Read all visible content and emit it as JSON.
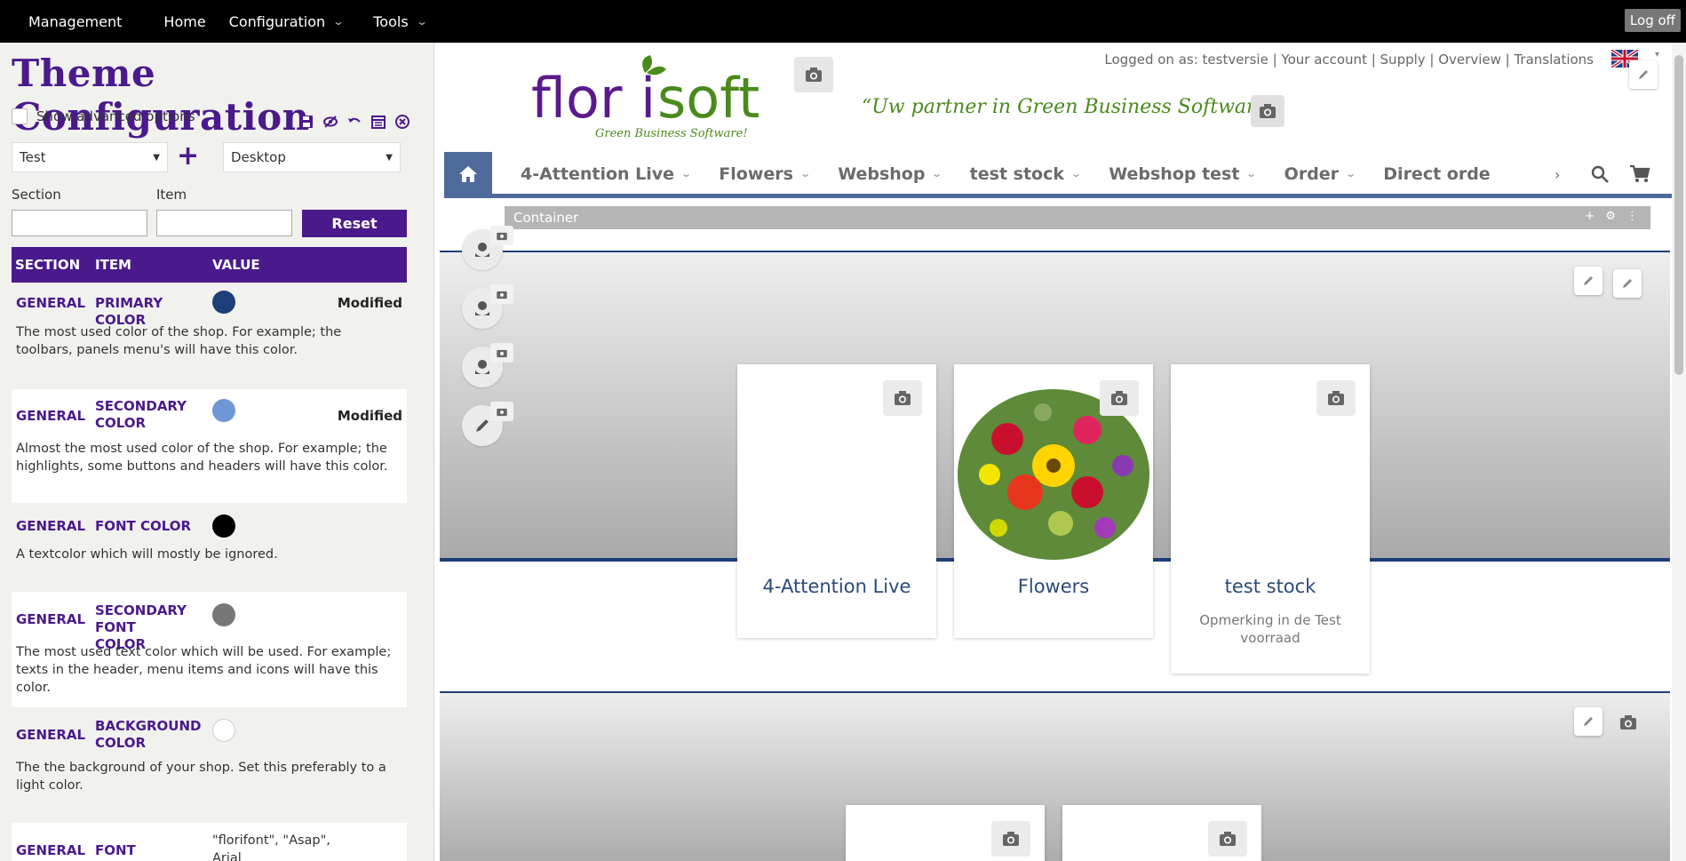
{
  "topbar": {
    "management": "Management",
    "home": "Home",
    "configuration": "Configuration",
    "tools": "Tools",
    "logoff": "Log off"
  },
  "panel": {
    "title": "Theme Configuration",
    "show_advanced": "Show advanced options",
    "theme_select": "Test",
    "device_select": "Desktop",
    "section_label": "Section",
    "item_label": "Item",
    "section_value": "",
    "item_value": "",
    "reset": "Reset",
    "columns": {
      "section": "SECTION",
      "item": "ITEM",
      "value": "VALUE"
    },
    "rows": [
      {
        "section": "GENERAL",
        "item": "PRIMARY COLOR",
        "color": "#1c3f7a",
        "status": "Modified",
        "desc": "The most used color of the shop. For example; the toolbars, panels menu's will have this color."
      },
      {
        "section": "GENERAL",
        "item": "SECONDARY COLOR",
        "color": "#6f97d6",
        "status": "Modified",
        "desc": "Almost the most used color of the shop. For example; the highlights, some buttons and headers will have this color."
      },
      {
        "section": "GENERAL",
        "item": "FONT COLOR",
        "color": "#000000",
        "status": "",
        "desc": "A textcolor which will mostly be ignored."
      },
      {
        "section": "GENERAL",
        "item": "SECONDARY FONT COLOR",
        "color": "#777777",
        "status": "",
        "desc": "The most used text color which will be used. For example; texts in the header, menu items and icons will have this color."
      },
      {
        "section": "GENERAL",
        "item": "BACKGROUND COLOR",
        "color": "#ffffff",
        "status": "",
        "desc": "The the background of your shop. Set this preferably to a light color."
      },
      {
        "section": "GENERAL",
        "item": "FONT",
        "value": "\"florifont\", \"Asap\", Arial",
        "status": "",
        "desc": ""
      }
    ]
  },
  "site": {
    "logo_text": "florisoft",
    "logo_sub": "Green Business Software!",
    "tagline": "“Uw partner in Green Business Software!”",
    "top_links": "Logged on as: testversie | Your account | Supply | Overview | Translations",
    "menu": [
      "4-Attention Live",
      "Flowers",
      "Webshop",
      "test stock",
      "Webshop test",
      "Order",
      "Direct orde"
    ],
    "container_label": "Container",
    "cards": [
      {
        "title": "4-Attention Live",
        "sub": ""
      },
      {
        "title": "Flowers",
        "sub": ""
      },
      {
        "title": "test stock",
        "sub": "Opmerking in de Test voorraad"
      }
    ]
  },
  "colors": {
    "purple": "#4a1a8c",
    "navy": "#1c3f7a",
    "nav_blue": "#4d6a9a",
    "green": "#4a8a1c"
  }
}
